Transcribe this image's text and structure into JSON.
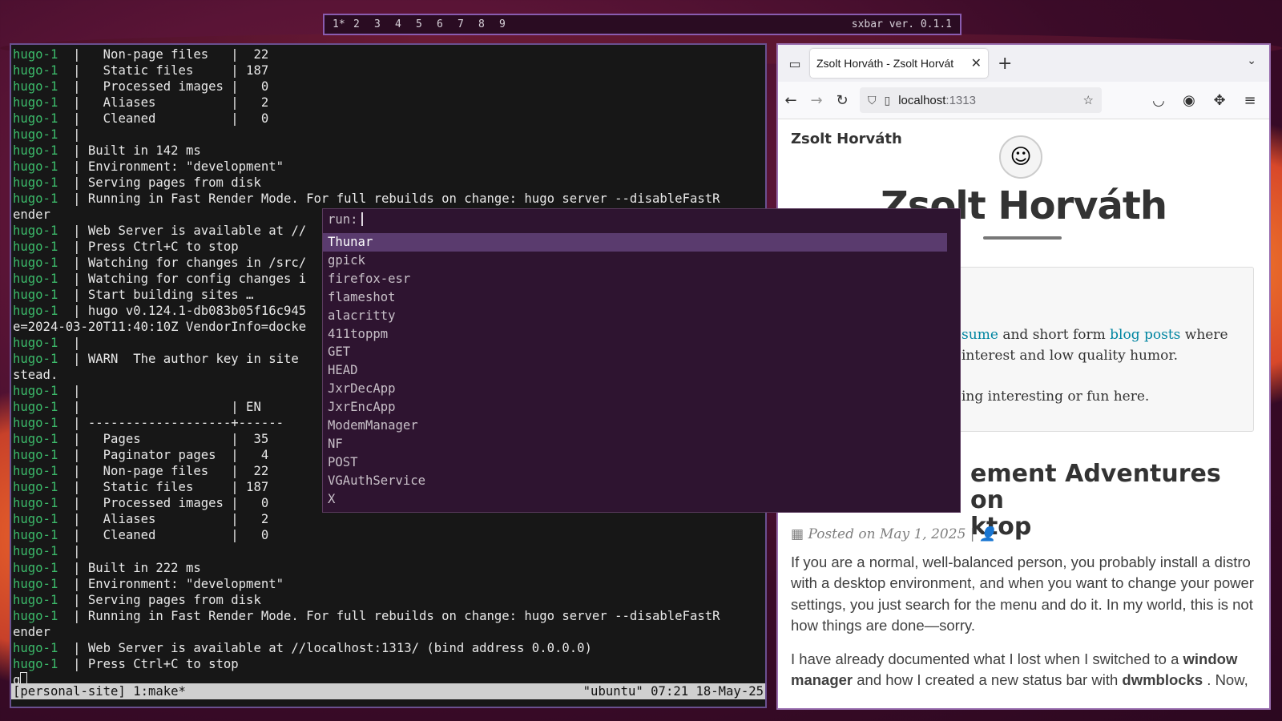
{
  "bar": {
    "workspaces": [
      "1*",
      "2",
      "3",
      "4",
      "5",
      "6",
      "7",
      "8",
      "9"
    ],
    "title": "sxbar ver. 0.1.1"
  },
  "terminal": {
    "lines": [
      [
        "hugo-1",
        "  |   Non-page files   |  22"
      ],
      [
        "hugo-1",
        "  |   Static files     | 187"
      ],
      [
        "hugo-1",
        "  |   Processed images |   0"
      ],
      [
        "hugo-1",
        "  |   Aliases          |   2"
      ],
      [
        "hugo-1",
        "  |   Cleaned          |   0"
      ],
      [
        "hugo-1",
        "  |"
      ],
      [
        "hugo-1",
        "  | Built in 142 ms"
      ],
      [
        "hugo-1",
        "  | Environment: \"development\""
      ],
      [
        "hugo-1",
        "  | Serving pages from disk"
      ],
      [
        "hugo-1",
        "  | Running in Fast Render Mode. For full rebuilds on change: hugo server --disableFastR"
      ],
      [
        "",
        "ender"
      ],
      [
        "hugo-1",
        "  | Web Server is available at //"
      ],
      [
        "hugo-1",
        "  | Press Ctrl+C to stop"
      ],
      [
        "hugo-1",
        "  | Watching for changes in /src/"
      ],
      [
        "hugo-1",
        "  | Watching for config changes i"
      ],
      [
        "hugo-1",
        "  | Start building sites …"
      ],
      [
        "hugo-1",
        "  | hugo v0.124.1-db083b05f16c945"
      ],
      [
        "",
        "e=2024-03-20T11:40:10Z VendorInfo=docke"
      ],
      [
        "hugo-1",
        "  |"
      ],
      [
        "hugo-1",
        "  | WARN  The author key in site"
      ],
      [
        "",
        "stead."
      ],
      [
        "hugo-1",
        "  |"
      ],
      [
        "hugo-1",
        "  |                    | EN"
      ],
      [
        "hugo-1",
        "  | -------------------+------"
      ],
      [
        "hugo-1",
        "  |   Pages            |  35"
      ],
      [
        "hugo-1",
        "  |   Paginator pages  |   4"
      ],
      [
        "hugo-1",
        "  |   Non-page files   |  22"
      ],
      [
        "hugo-1",
        "  |   Static files     | 187"
      ],
      [
        "hugo-1",
        "  |   Processed images |   0"
      ],
      [
        "hugo-1",
        "  |   Aliases          |   2"
      ],
      [
        "hugo-1",
        "  |   Cleaned          |   0"
      ],
      [
        "hugo-1",
        "  |"
      ],
      [
        "hugo-1",
        "  | Built in 222 ms"
      ],
      [
        "hugo-1",
        "  | Environment: \"development\""
      ],
      [
        "hugo-1",
        "  | Serving pages from disk"
      ],
      [
        "hugo-1",
        "  | Running in Fast Render Mode. For full rebuilds on change: hugo server --disableFastR"
      ],
      [
        "",
        "ender"
      ],
      [
        "hugo-1",
        "  | Web Server is available at //localhost:1313/ (bind address 0.0.0.0)"
      ],
      [
        "hugo-1",
        "  | Press Ctrl+C to stop"
      ]
    ],
    "input": "q",
    "tmux_left": "[personal-site] 1:make*",
    "tmux_right": "\"ubuntu\" 07:21 18-May-25"
  },
  "launcher": {
    "prompt": "run:",
    "items": [
      "Thunar",
      "gpick",
      "firefox-esr",
      "flameshot",
      "alacritty",
      "411toppm",
      "GET",
      "HEAD",
      "JxrDecApp",
      "JxrEncApp",
      "ModemManager",
      "NF",
      "POST",
      "VGAuthService",
      "X"
    ],
    "selected_index": 0
  },
  "browser": {
    "tab_title": "Zsolt Horváth - Zsolt Horvát",
    "url_host": "localhost",
    "url_port": ":1313",
    "icons": {
      "tabs": "tabs-icon",
      "close": "close-icon",
      "new_tab": "plus-icon",
      "list": "chevron-down-icon",
      "back": "back-arrow-icon",
      "forward": "forward-arrow-icon",
      "reload": "reload-icon",
      "shield": "shield-icon",
      "page": "page-icon",
      "star": "star-icon",
      "pocket": "pocket-icon",
      "account": "account-icon",
      "extensions": "extensions-icon",
      "menu": "hamburger-menu-icon"
    }
  },
  "site": {
    "brand": "Zsolt Horváth",
    "hero_title": "Zsolt Horváth",
    "intro": {
      "line1_link1": "esume",
      "line1_mid": " and short form ",
      "line1_link2": "blog posts",
      "line1_end": " where",
      "line2": "interest and low quality humor.",
      "line3": "ing interesting or fun here."
    },
    "post_title_line1": "ement Adventures on",
    "post_title_line2": "ktop",
    "post_meta": "Posted on May 1, 2025",
    "post_meta_sep": "|",
    "para1": "If you are a normal, well-balanced person, you probably install a distro with a desktop environment, and when you want to change your power settings, you just search for the menu and do it. In my world, this is not how things are done—sorry.",
    "para2_start": "I have already documented what I lost when I switched to a ",
    "para2_bold1": "window manager",
    "para2_mid": " and how I created a new status bar with ",
    "para2_bold2": "dwmblocks",
    "para2_end": " . Now,"
  },
  "colors": {
    "terminal_prefix": "#3cba6a",
    "launcher_bg": "#2e1430",
    "launcher_selected": "#5a3b6e",
    "link": "#0085a1",
    "bar_border": "#8a5cb0"
  }
}
